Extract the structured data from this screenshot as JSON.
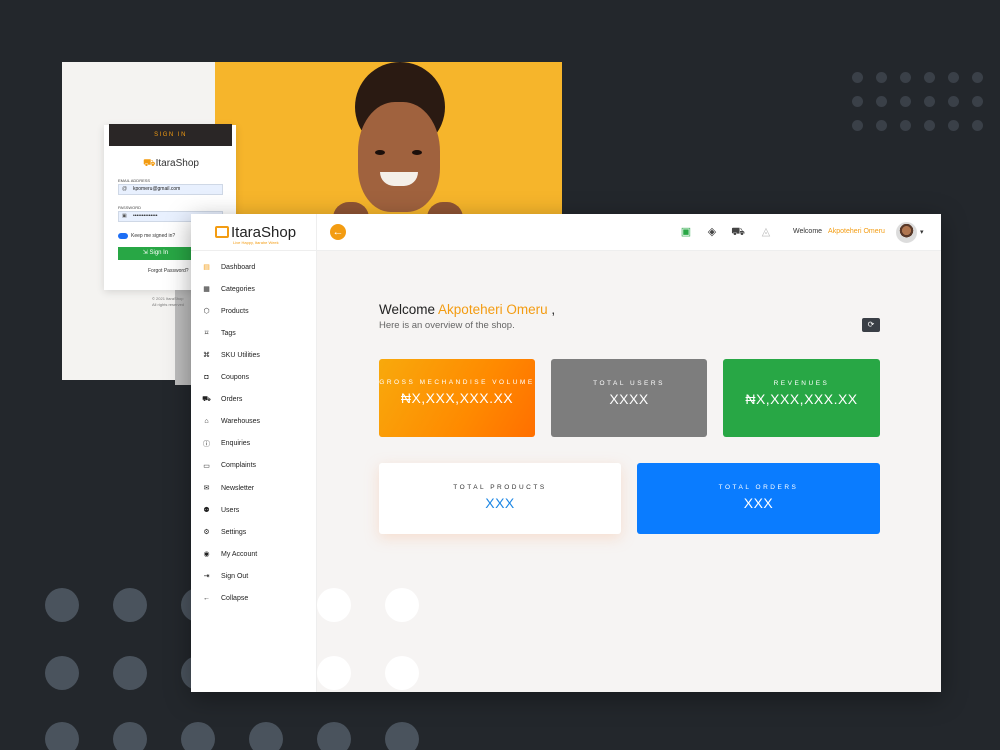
{
  "login": {
    "header": "SIGN IN",
    "logo": "ItaraShop",
    "email_label": "EMAIL ADDRESS",
    "email_value": "kpomeru@gmail.com",
    "password_label": "PASSWORD",
    "password_value": "••••••••••••••",
    "keep_signed_in": "Keep me signed in?",
    "signin_button": "Sign In",
    "forgot": "Forgot Password?",
    "copyright_1": "© 2021 ItaraShop",
    "copyright_2": "All rights reserved"
  },
  "app": {
    "brand": "ItaraShop",
    "tagline": "Live Happy, Itarahe Week",
    "welcome_prefix": "Welcome",
    "user_name": "Akpoteheri Omeru",
    "accent_color": "#f39c12"
  },
  "sidebar": {
    "items": [
      {
        "label": "Dashboard",
        "icon": "dashboard-icon",
        "glyph": "▤"
      },
      {
        "label": "Categories",
        "icon": "categories-icon",
        "glyph": "▦"
      },
      {
        "label": "Products",
        "icon": "products-icon",
        "glyph": "⬡"
      },
      {
        "label": "Tags",
        "icon": "tag-icon",
        "glyph": "⌑"
      },
      {
        "label": "SKU Utilities",
        "icon": "sku-icon",
        "glyph": "⌘"
      },
      {
        "label": "Coupons",
        "icon": "coupon-icon",
        "glyph": "◘"
      },
      {
        "label": "Orders",
        "icon": "cart-icon",
        "glyph": "⛟"
      },
      {
        "label": "Warehouses",
        "icon": "warehouse-icon",
        "glyph": "⌂"
      },
      {
        "label": "Enquiries",
        "icon": "enquiry-icon",
        "glyph": "ⓘ"
      },
      {
        "label": "Complaints",
        "icon": "complaint-icon",
        "glyph": "▭"
      },
      {
        "label": "Newsletter",
        "icon": "envelope-icon",
        "glyph": "✉"
      },
      {
        "label": "Users",
        "icon": "users-icon",
        "glyph": "⚉"
      },
      {
        "label": "Settings",
        "icon": "settings-icon",
        "glyph": "⚙"
      },
      {
        "label": "My Account",
        "icon": "account-icon",
        "glyph": "◉"
      },
      {
        "label": "Sign Out",
        "icon": "signout-icon",
        "glyph": "⇥"
      },
      {
        "label": "Collapse",
        "icon": "collapse-icon",
        "glyph": "←"
      }
    ]
  },
  "overview": {
    "welcome": "Welcome",
    "name": "Akpoteheri Omeru",
    "suffix": ",",
    "subtitle": "Here is an overview of the shop."
  },
  "cards": {
    "gmv_title": "GROSS MECHANDISE VOLUME",
    "gmv_value": "₦X,XXX,XXX.XX",
    "users_title": "TOTAL USERS",
    "users_value": "XXXX",
    "revenue_title": "REVENUES",
    "revenue_value": "₦X,XXX,XXX.XX",
    "products_title": "TOTAL PRODUCTS",
    "products_value": "XXX",
    "orders_title": "TOTAL ORDERS",
    "orders_value": "XXX"
  }
}
